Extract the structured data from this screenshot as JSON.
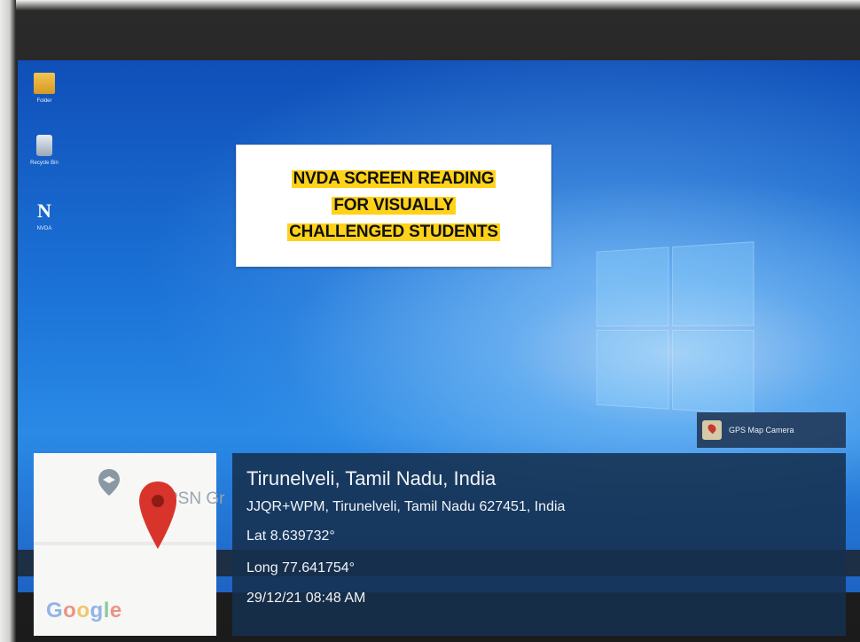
{
  "desktop": {
    "icons": [
      {
        "caption": "Folder",
        "icon": "folder-icon"
      },
      {
        "caption": "Recycle Bin",
        "icon": "recycle-bin-icon"
      },
      {
        "caption": "NVDA",
        "icon": "nvda-icon"
      }
    ]
  },
  "banner": {
    "lines": [
      "NVDA SCREEN READING",
      "FOR VISUALLY",
      "CHALLENGED STUDENTS"
    ]
  },
  "gps_overlay": {
    "app_label": "GPS Map Camera",
    "map_place_label": "PSN Gr",
    "map_brand": [
      "G",
      "o",
      "o",
      "g",
      "l",
      "e"
    ],
    "location_title": "Tirunelveli, Tamil Nadu, India",
    "address": "JJQR+WPM, Tirunelveli, Tamil Nadu 627451, India",
    "latitude": "Lat 8.639732°",
    "longitude": "Long 77.641754°",
    "timestamp": "29/12/21 08:48 AM"
  },
  "colors": {
    "banner_highlight": "#ffd21a",
    "overlay_bg": "#16304e",
    "map_pin": "#d9342b"
  }
}
